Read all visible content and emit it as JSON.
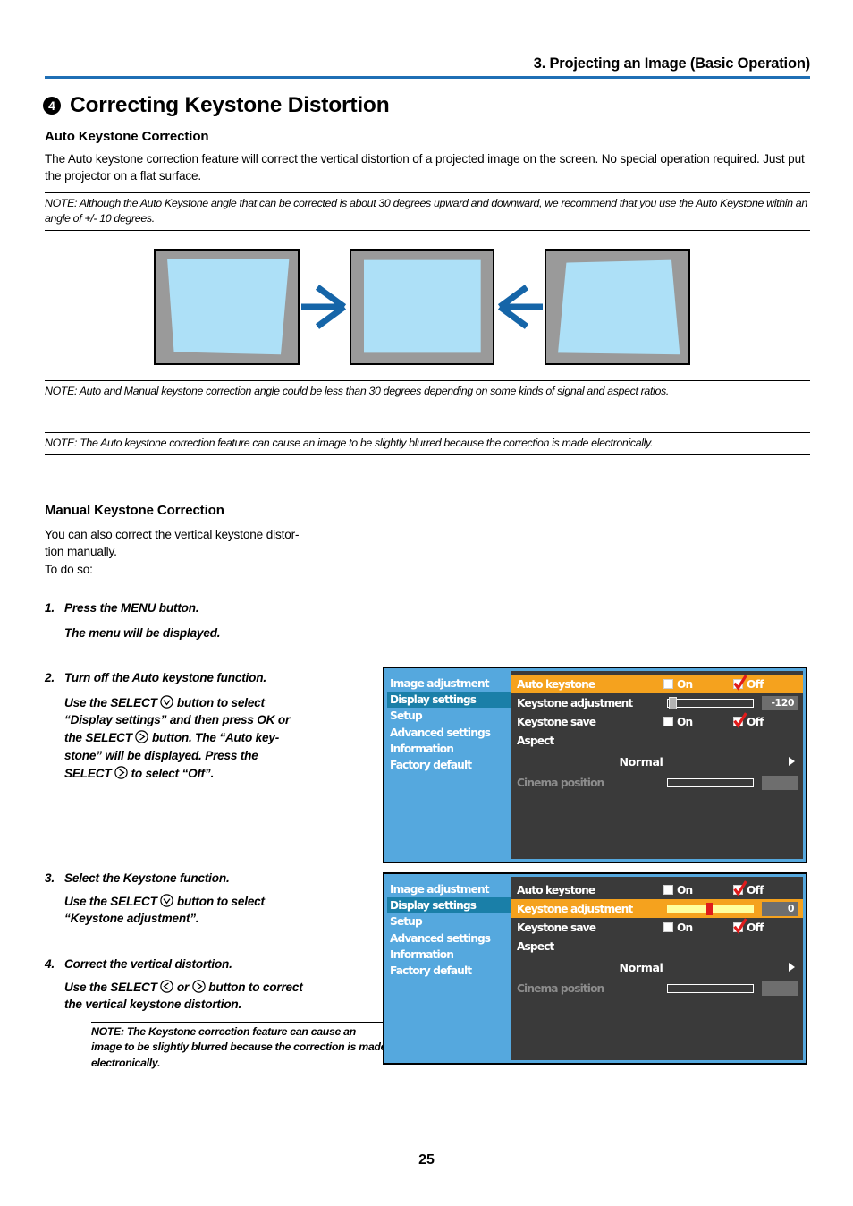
{
  "header": {
    "chapter_title": "3. Projecting an Image (Basic Operation)",
    "rule_color": "#1F6FB5"
  },
  "section": {
    "number": "4",
    "title": "Correcting Keystone Distortion"
  },
  "auto_section": {
    "heading": "Auto Keystone Correction",
    "body": "The Auto keystone correction feature will correct the vertical distortion of a projected image on the screen. No special operation required. Just put the projector on a flat surface.",
    "note1": "NOTE: Although the Auto Keystone angle that can be corrected is about 30 degrees upward and downward, we recommend that you use the Auto Keystone within an angle of +/- 10 degrees.",
    "note2": "NOTE: Auto and Manual keystone correction angle could be less than 30 degrees depending on some kinds of signal and aspect ratios.",
    "note3": "NOTE: The Auto keystone correction feature can cause an image to be slightly blurred because the correction is made electronically."
  },
  "diagram": {
    "screen_fill": "#ADE0F7",
    "screen_frame": "#9A9A9A",
    "arrow_color": "#1565A8",
    "panels": [
      {
        "name": "distorted-top-wide",
        "shape": "trapezoid-wide-top"
      },
      {
        "name": "corrected-rectangle",
        "shape": "rectangle"
      },
      {
        "name": "distorted-bottom-wide",
        "shape": "trapezoid-wide-bottom"
      }
    ]
  },
  "manual_section": {
    "heading": "Manual Keystone Correction",
    "intro_line1": "You can also correct the vertical keystone distor-",
    "intro_line2": "tion manually.",
    "intro_line3": "To do so:",
    "steps": [
      {
        "num": "1.",
        "title": "Press the MENU button.",
        "body_pre": "The menu will be displayed.",
        "body_parts": []
      },
      {
        "num": "2.",
        "title": "Turn off the Auto keystone function.",
        "body_parts": [
          "Use the SELECT ",
          " button to select",
          "“Display settings” and then press OK or",
          "the SELECT ",
          " button. The “Auto key-",
          "stone” will be displayed.  Press the",
          "SELECT ",
          " to select “Off”."
        ]
      },
      {
        "num": "3.",
        "title": "Select the Keystone function.",
        "body_parts": [
          "Use the SELECT ",
          " button to select",
          "“Keystone adjustment”."
        ]
      },
      {
        "num": "4.",
        "title": "Correct the vertical distortion.",
        "body_parts": [
          "Use the SELECT ",
          " or ",
          " button to correct",
          "the vertical keystone distortion."
        ],
        "note": "NOTE: The Keystone correction feature can cause an image to be slightly blurred because the correction is made electronically."
      }
    ]
  },
  "osd": {
    "sidebar_items": [
      "Image adjustment",
      "Display settings",
      "Setup",
      "Advanced settings",
      "Information",
      "Factory default"
    ],
    "selected_sidebar": "Display settings",
    "colors": {
      "sidebar_bg": "#55A8DE",
      "sidebar_selected": "#1A7FA8",
      "panel_bg": "#3A3A3A",
      "highlight": "#F5A21E",
      "check_red": "#E01B1B",
      "slider_fill": "#FFFF9E",
      "value_box": "#6E6E6E",
      "dim_text": "#8C8C8C"
    },
    "labels": {
      "auto_keystone": "Auto keystone",
      "keystone_adjustment": "Keystone adjustment",
      "keystone_save": "Keystone save",
      "aspect": "Aspect",
      "aspect_value": "Normal",
      "cinema_position": "Cinema position",
      "on": "On",
      "off": "Off"
    },
    "menu1": {
      "highlighted_row": "Auto keystone",
      "auto_keystone_selected": "Off",
      "keystone_adjustment_value": "-120",
      "keystone_save_selected": "Off",
      "cinema_position_value": ""
    },
    "menu2": {
      "highlighted_row": "Keystone adjustment",
      "auto_keystone_selected": "Off",
      "keystone_adjustment_value": "0",
      "keystone_save_selected": "Off",
      "cinema_position_value": ""
    }
  },
  "footer": {
    "page_number": "25"
  }
}
